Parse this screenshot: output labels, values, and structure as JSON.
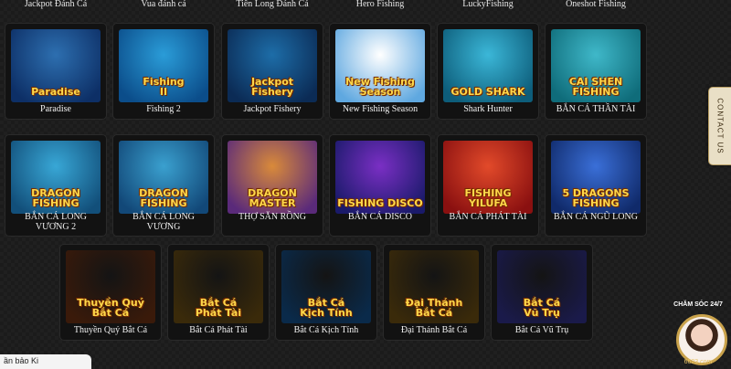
{
  "top_row": [
    {
      "label": "Jackpot Đánh Cá"
    },
    {
      "label": "Vua đánh cá"
    },
    {
      "label": "Tiên Long Đánh Cá"
    },
    {
      "label": "Hero Fishing"
    },
    {
      "label": "LuckyFishing"
    },
    {
      "label": "Oneshot Fishing"
    }
  ],
  "row1": [
    {
      "label": "Paradise",
      "logo": "Paradise",
      "bg": "#2d6fb0",
      "bg2": "#0d2f66"
    },
    {
      "label": "Fishing 2",
      "logo": "Fishing\nII",
      "bg": "#2a9cd8",
      "bg2": "#0b4d8a"
    },
    {
      "label": "Jackpot Fishery",
      "logo": "Jackpot Fishery",
      "bg": "#1d6da8",
      "bg2": "#0b2b55"
    },
    {
      "label": "New Fishing Season",
      "logo": "New Fishing\nSeason",
      "bg": "#ffffff",
      "bg2": "#5fa8e0"
    },
    {
      "label": "Shark Hunter",
      "logo": "GOLD SHARK",
      "bg": "#3bb7d8",
      "bg2": "#0d5d7a"
    },
    {
      "label": "BẮN CÁ THẦN TÀI",
      "logo": "CAI SHEN\nFISHING",
      "bg": "#3fb8c9",
      "bg2": "#0f6c7a"
    }
  ],
  "row2": [
    {
      "label": "BẮN CÁ LONG VƯƠNG 2",
      "logo": "DRAGON\nFISHING",
      "bg": "#38a7d6",
      "bg2": "#124f7a"
    },
    {
      "label": "BẮN CÁ LONG VƯƠNG",
      "logo": "DRAGON\nFISHING",
      "bg": "#3aa0cf",
      "bg2": "#124878"
    },
    {
      "label": "THỢ SĂN RỒNG",
      "logo": "DRAGON\nMASTER",
      "bg": "#d98a3a",
      "bg2": "#5a2a7a"
    },
    {
      "label": "BẮN CÁ DISCO",
      "logo": "FISHING DISCO",
      "bg": "#7a2fc4",
      "bg2": "#1a1a6a"
    },
    {
      "label": "BẮN CÁ PHÁT TÀI",
      "logo": "FISHING\nYILUFA",
      "bg": "#e24a2a",
      "bg2": "#8a1010"
    },
    {
      "label": "BẮN CÁ NGŨ LONG",
      "logo": "5 DRAGONS\nFISHING",
      "bg": "#3a6fd8",
      "bg2": "#102a6a"
    }
  ],
  "row3": [
    {
      "label": "Thuyền Quý Bắt Cá",
      "logo": "Thuyền Quý\nBắt Cá",
      "bg": "#141414",
      "bg2": "#3a1a0a"
    },
    {
      "label": "Bắt Cá Phát Tài",
      "logo": "Bắt Cá\nPhát Tài",
      "bg": "#141414",
      "bg2": "#3a2a0a"
    },
    {
      "label": "Bắt Cá Kịch Tính",
      "logo": "Bắt Cá\nKịch Tính",
      "bg": "#141414",
      "bg2": "#0a2a4a"
    },
    {
      "label": "Đại Thánh Bắt Cá",
      "logo": "Đại Thánh\nBắt Cá",
      "bg": "#141414",
      "bg2": "#3a2a0a"
    },
    {
      "label": "Bắt Cá Vũ Trụ",
      "logo": "Bắt Cá\nVũ Trụ",
      "bg": "#141414",
      "bg2": "#1a1a4a"
    }
  ],
  "contact_tab": {
    "label": "CONTACT US"
  },
  "support": {
    "title": "CHĂM SÓC 24/7",
    "number": "6623.com"
  },
  "chip": {
    "text": "ần bảo Ki"
  }
}
